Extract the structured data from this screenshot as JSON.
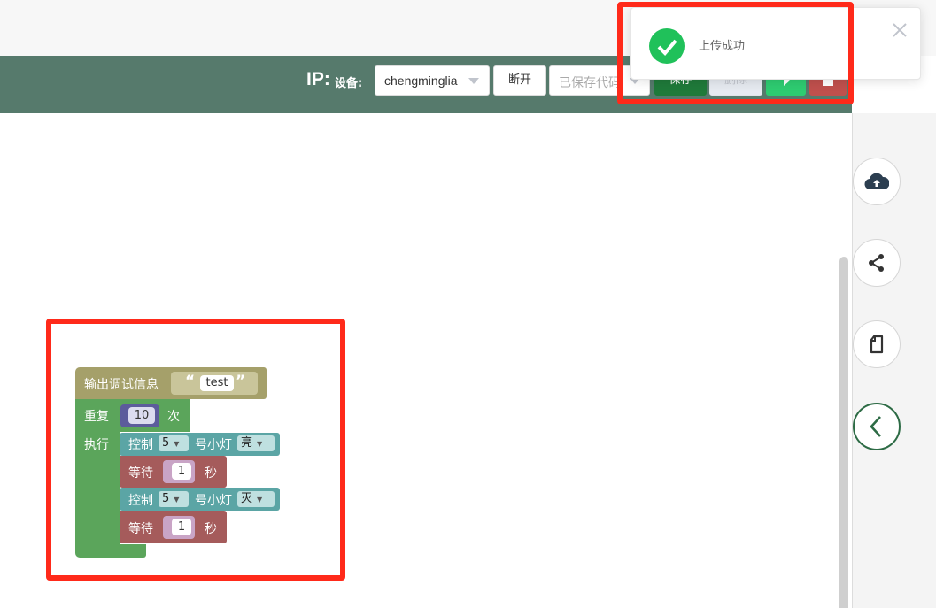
{
  "toolbar": {
    "ip_label": "IP:",
    "device_label": "设备:",
    "device_value": "chengminglia",
    "disconnect_label": "断开",
    "saved_code_placeholder": "已保存代码",
    "save_label": "保存",
    "delete_label": "删除",
    "run_icon": "play-icon",
    "stop_icon": "stop-icon"
  },
  "toast": {
    "message": "上传成功",
    "icon": "check-circle-icon",
    "close_icon": "close-icon",
    "status_color": "#20c15a"
  },
  "sidebar": {
    "buttons": [
      "cloud-upload-icon",
      "share-icon",
      "file-icon",
      "chevron-left-icon"
    ]
  },
  "blocks": {
    "print": {
      "label": "输出调试信息",
      "quote_open": "“",
      "value": "test",
      "quote_close": "”"
    },
    "repeat": {
      "label": "重复",
      "count": "10",
      "times_label": "次",
      "do_label": "执行"
    },
    "steps": [
      {
        "control_label": "控制",
        "pin": "5",
        "light_label": "号小灯",
        "state": "亮"
      },
      {
        "wait_label": "等待",
        "seconds": "1",
        "unit": "秒"
      },
      {
        "control_label": "控制",
        "pin": "5",
        "light_label": "号小灯",
        "state": "灭"
      },
      {
        "wait_label": "等待",
        "seconds": "1",
        "unit": "秒"
      }
    ]
  },
  "colors": {
    "toolbar_bg": "#567a6c",
    "highlight": "#ff2a1a",
    "print_block": "#a5a06a",
    "repeat_block": "#5ba55b",
    "control_block": "#5ba5a5",
    "wait_block": "#a55b5b"
  }
}
